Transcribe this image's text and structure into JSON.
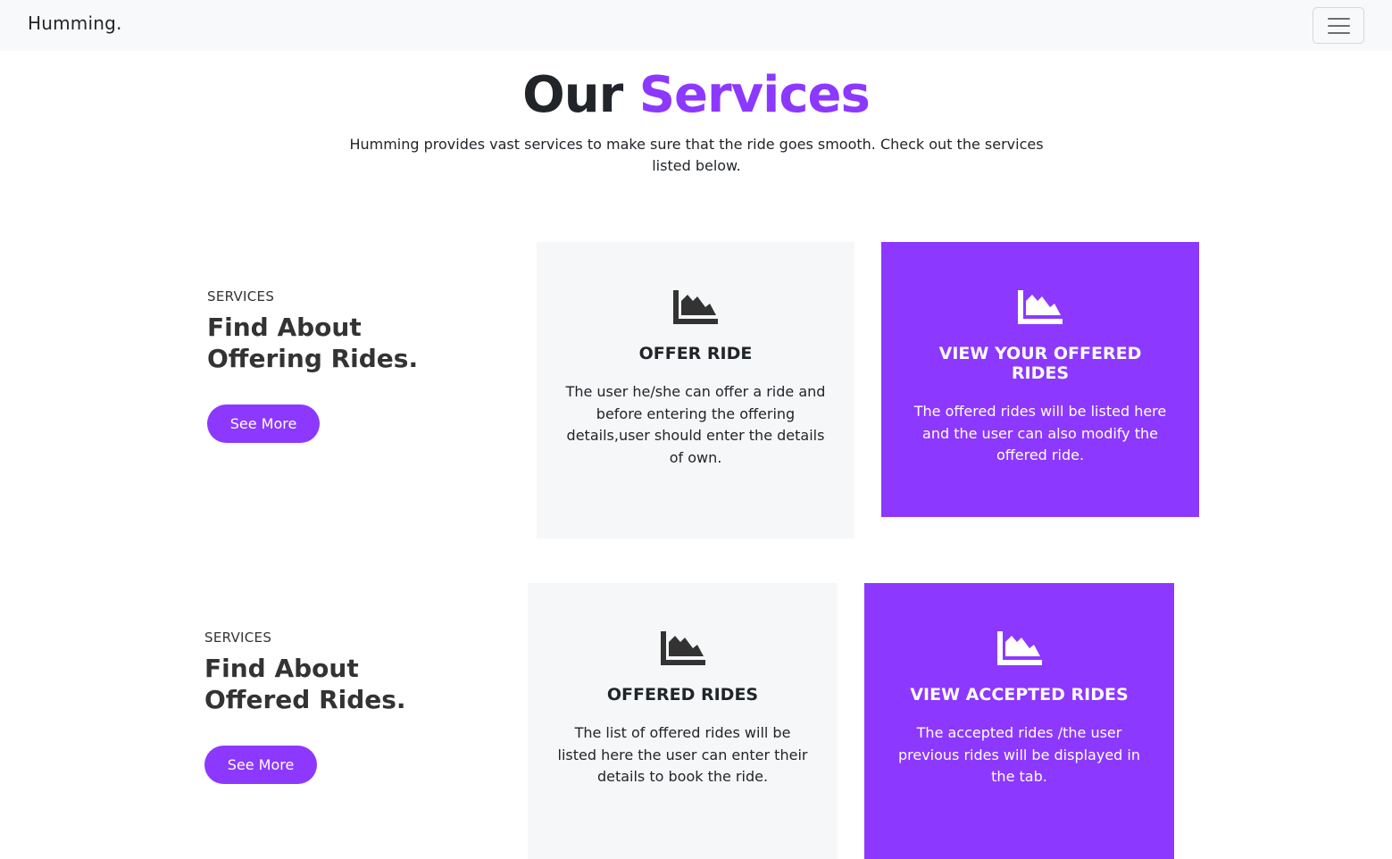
{
  "navbar": {
    "brand": "Humming.",
    "toggle_icon": "hamburger-menu-icon"
  },
  "hero": {
    "title_plain": "Our",
    "title_accent": "Services",
    "subtitle": "Humming provides vast services to make sure that the ride goes smooth. Check out the services listed below."
  },
  "colors": {
    "accent": "#8c38ff",
    "light_card": "#f6f7f8",
    "navbar_bg": "#f8f9fa",
    "text": "#212529"
  },
  "sections": [
    {
      "eyebrow": "SERVICES",
      "heading": "Find About Offering Rides.",
      "button": "See More",
      "cards": [
        {
          "icon": "area-chart-icon",
          "title": "OFFER RIDE",
          "body": "The user he/she can offer a ride and before entering the offering details,user should enter the details of own."
        },
        {
          "icon": "area-chart-icon",
          "title": "VIEW YOUR OFFERED RIDES",
          "body": "The offered rides will be listed here and the user can also modify the offered ride."
        }
      ]
    },
    {
      "eyebrow": "SERVICES",
      "heading": "Find About Offered Rides.",
      "button": "See More",
      "cards": [
        {
          "icon": "area-chart-icon",
          "title": "OFFERED RIDES",
          "body": "The list of offered rides will be listed here the user can enter their details to book the ride."
        },
        {
          "icon": "area-chart-icon",
          "title": "VIEW ACCEPTED RIDES",
          "body": "The accepted rides /the user previous rides will be displayed in the tab."
        }
      ]
    }
  ]
}
